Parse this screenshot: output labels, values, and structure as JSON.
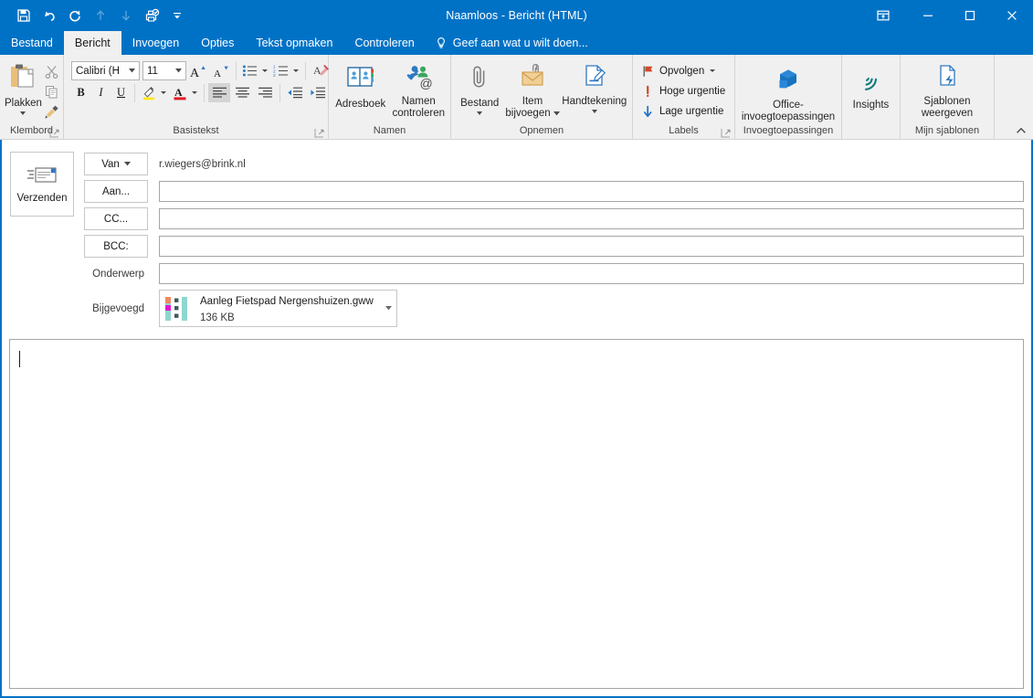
{
  "window": {
    "title": "Naamloos - Bericht (HTML)",
    "accent_color": "#0072c6",
    "ribbon_bg": "#f0f0f0"
  },
  "quick_access": [
    {
      "name": "save",
      "icon": "save-icon",
      "enabled": true
    },
    {
      "name": "undo",
      "icon": "undo-icon",
      "enabled": true
    },
    {
      "name": "redo",
      "icon": "redo-icon",
      "enabled": true
    },
    {
      "name": "previous-item",
      "icon": "arrow-up-icon",
      "enabled": false
    },
    {
      "name": "next-item",
      "icon": "arrow-down-icon",
      "enabled": false
    },
    {
      "name": "print-preview",
      "icon": "print-preview-icon",
      "enabled": true
    },
    {
      "name": "customize-quick-access-toolbar",
      "icon": "chevron-down-bar-icon",
      "enabled": true
    }
  ],
  "window_controls": {
    "ribbon_display_options": "ribbon-display-options-icon",
    "minimize": "minimize-icon",
    "maximize": "maximize-icon",
    "close": "close-icon"
  },
  "tabs": [
    {
      "label": "Bestand",
      "active": false
    },
    {
      "label": "Bericht",
      "active": true
    },
    {
      "label": "Invoegen",
      "active": false
    },
    {
      "label": "Opties",
      "active": false
    },
    {
      "label": "Tekst opmaken",
      "active": false
    },
    {
      "label": "Controleren",
      "active": false
    }
  ],
  "tell_me": {
    "placeholder": "Geef aan wat u wilt doen...",
    "icon": "lightbulb-icon"
  },
  "ribbon": {
    "groups": [
      {
        "name": "klembord",
        "label": "Klembord",
        "dialog_launcher": true,
        "big_buttons": [
          {
            "label": "Plakken",
            "icon": "paste-icon",
            "has_dropdown": true
          }
        ],
        "small_buttons": [
          {
            "label": "Knippen",
            "icon": "scissors-icon"
          },
          {
            "label": "Kopiëren",
            "icon": "copy-icon"
          },
          {
            "label": "Opmaak kopiëren/plakken",
            "icon": "format-painter-icon"
          }
        ]
      },
      {
        "name": "basistekst",
        "label": "Basistekst",
        "dialog_launcher": true,
        "font_name": "Calibri (H",
        "font_size": "11",
        "row1": [
          {
            "label": "Tekengrootte vergroten",
            "icon": "grow-font-icon"
          },
          {
            "label": "Tekengrootte verkleinen",
            "icon": "shrink-font-icon"
          },
          {
            "label": "Opsommingstekens",
            "icon": "bullets-icon",
            "has_dropdown": true
          },
          {
            "label": "Nummering",
            "icon": "numbering-icon",
            "has_dropdown": true
          },
          {
            "label": "Alle opmaak wissen",
            "icon": "clear-formatting-icon"
          }
        ],
        "row2": [
          {
            "label": "Vet",
            "icon": "bold-icon",
            "glyph": "B"
          },
          {
            "label": "Cursief",
            "icon": "italic-icon",
            "glyph": "I"
          },
          {
            "label": "Onderstrepen",
            "icon": "underline-icon",
            "glyph": "U"
          },
          {
            "label": "Tekstmarkeringskleur",
            "icon": "highlight-icon",
            "has_dropdown": true
          },
          {
            "label": "Tekstkleur",
            "icon": "font-color-icon",
            "has_dropdown": true
          },
          {
            "label": "Links uitlijnen",
            "icon": "align-left-icon",
            "active": true
          },
          {
            "label": "Centreren",
            "icon": "align-center-icon"
          },
          {
            "label": "Rechts uitlijnen",
            "icon": "align-right-icon"
          },
          {
            "label": "Inspringing verkleinen",
            "icon": "decrease-indent-icon"
          },
          {
            "label": "Inspringing vergroten",
            "icon": "increase-indent-icon"
          }
        ]
      },
      {
        "name": "namen",
        "label": "Namen",
        "dialog_launcher": false,
        "big_buttons": [
          {
            "label": "Adresboek",
            "icon": "address-book-icon"
          },
          {
            "label": "Namen\ncontroleren",
            "line1": "Namen",
            "line2": "controleren",
            "icon": "check-names-icon"
          }
        ]
      },
      {
        "name": "opnemen",
        "label": "Opnemen",
        "dialog_launcher": false,
        "big_buttons": [
          {
            "label": "Bestand",
            "icon": "attach-file-icon",
            "has_dropdown": true
          },
          {
            "line1": "Item",
            "line2": "bijvoegen",
            "icon": "attach-item-icon",
            "has_dropdown": true
          },
          {
            "label": "Handtekening",
            "icon": "signature-icon",
            "has_dropdown": true
          }
        ]
      },
      {
        "name": "labels",
        "label": "Labels",
        "dialog_launcher": true,
        "items": [
          {
            "label": "Opvolgen",
            "icon": "flag-icon",
            "has_dropdown": true,
            "color": "#d24726"
          },
          {
            "label": "Hoge urgentie",
            "icon": "high-importance-icon",
            "color": "#d24726"
          },
          {
            "label": "Lage urgentie",
            "icon": "low-importance-icon",
            "color": "#1f6fc4"
          }
        ]
      },
      {
        "name": "invoegtoepassingen",
        "label": "Invoegtoepassingen",
        "dialog_launcher": false,
        "big_buttons": [
          {
            "line1": "Office-",
            "line2": "invoegtoepassingen",
            "icon": "office-addins-icon"
          }
        ]
      },
      {
        "name": "insights",
        "label": "",
        "dialog_launcher": false,
        "big_buttons": [
          {
            "label": "Insights",
            "icon": "insights-icon"
          }
        ]
      },
      {
        "name": "mijn-sjablonen",
        "label": "Mijn sjablonen",
        "dialog_launcher": false,
        "big_buttons": [
          {
            "line1": "Sjablonen",
            "line2": "weergeven",
            "icon": "view-templates-icon"
          }
        ]
      }
    ],
    "collapse_icon": "chevron-up-icon"
  },
  "compose": {
    "send_button": {
      "label": "Verzenden",
      "icon": "send-envelope-icon"
    },
    "fields": [
      {
        "name": "van",
        "label": "Van",
        "type": "button-dropdown",
        "value": "r.wiegers@brink.nl"
      },
      {
        "name": "aan",
        "label": "Aan...",
        "type": "button",
        "value": ""
      },
      {
        "name": "cc",
        "label": "CC...",
        "type": "button",
        "value": ""
      },
      {
        "name": "bcc",
        "label": "BCC:",
        "type": "button",
        "value": ""
      },
      {
        "name": "onderwerp",
        "label": "Onderwerp",
        "type": "static",
        "value": ""
      }
    ],
    "attachment_label": "Bijgevoegd",
    "attachment": {
      "filename": "Aanleg Fietspad Nergenshuizen.gww",
      "size": "136 KB",
      "icon": "gww-file-icon",
      "dropdown_icon": "chevron-down-icon"
    },
    "body": {
      "value": "",
      "has_caret": true
    }
  }
}
